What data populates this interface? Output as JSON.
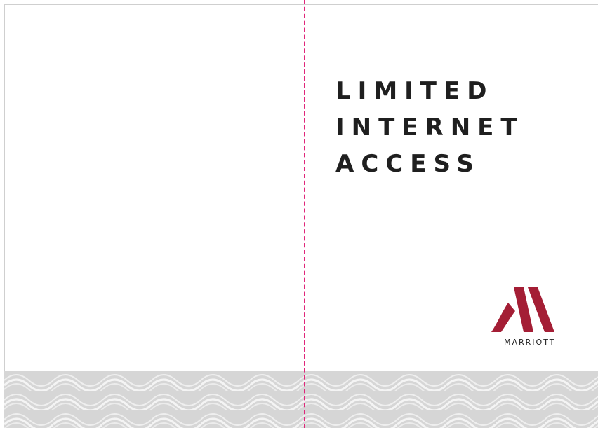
{
  "title_lines": [
    "LIMITED",
    "INTERNET",
    "ACCESS"
  ],
  "brand": {
    "wordmark": "MARRIOTT",
    "logo_color": "#a41e35"
  },
  "colors": {
    "fold_line": "#e0267a",
    "title": "#1f1f1f",
    "pattern_bg": "#d9d9d9",
    "pattern_wave": "#f2f2f2"
  }
}
